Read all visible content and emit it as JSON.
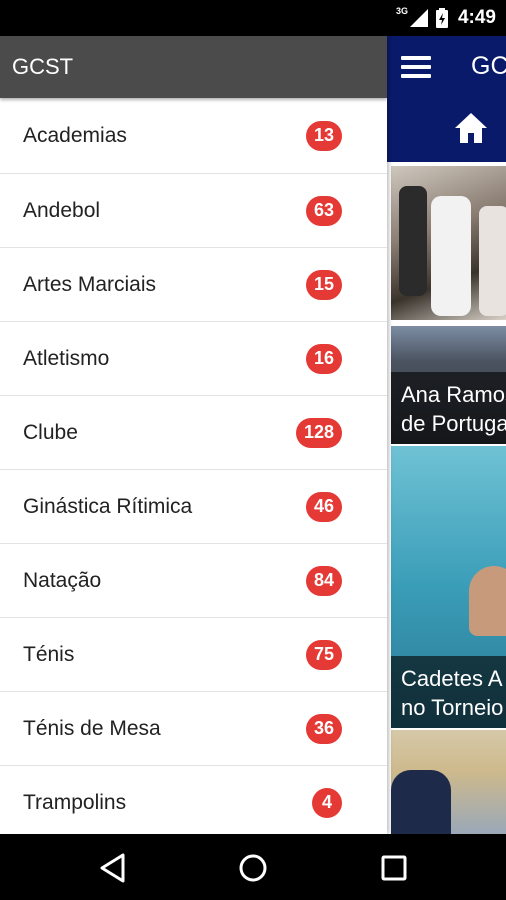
{
  "status_bar": {
    "network": "3G",
    "time": "4:49"
  },
  "app": {
    "title": "GCST",
    "news": [
      {
        "caption_line1": "Ana Ramos",
        "caption_line2": "de Portugal"
      },
      {
        "caption_line1": "Cadetes A",
        "caption_line2": "no Torneio"
      }
    ]
  },
  "drawer": {
    "title": "GCST",
    "items": [
      {
        "label": "Academias",
        "count": "13"
      },
      {
        "label": "Andebol",
        "count": "63"
      },
      {
        "label": "Artes Marciais",
        "count": "15"
      },
      {
        "label": "Atletismo",
        "count": "16"
      },
      {
        "label": "Clube",
        "count": "128"
      },
      {
        "label": "Ginástica Rítimica",
        "count": "46"
      },
      {
        "label": "Natação",
        "count": "84"
      },
      {
        "label": "Ténis",
        "count": "75"
      },
      {
        "label": "Ténis de Mesa",
        "count": "36"
      },
      {
        "label": "Trampolins",
        "count": "4"
      }
    ]
  },
  "colors": {
    "drawer_header": "#4b4b4b",
    "badge": "#e53935",
    "app_toolbar": "#0a1a6b"
  },
  "icons": {
    "menu": "menu-icon",
    "home": "home-icon",
    "back": "back-icon",
    "nav_home": "circle-home-icon",
    "recents": "recents-icon"
  }
}
